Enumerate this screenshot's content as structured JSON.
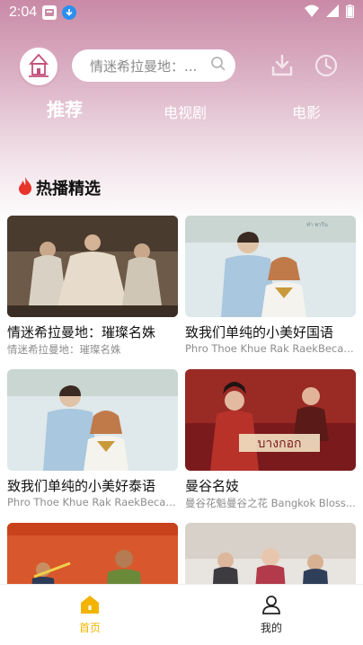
{
  "status_bar": {
    "time": "2:04"
  },
  "search": {
    "placeholder": "情迷希拉曼地：..."
  },
  "tabs": [
    {
      "label": "推荐",
      "active": true
    },
    {
      "label": "电视剧",
      "active": false
    },
    {
      "label": "电影",
      "active": false
    }
  ],
  "section": {
    "title": "热播精选"
  },
  "cards": [
    {
      "title": "情迷希拉曼地：璀璨名姝",
      "subtitle": "情迷希拉曼地：璀璨名姝",
      "poster": "thai-royal-drama-poster"
    },
    {
      "title": "致我们单纯的小美好国语",
      "subtitle": "Phro Thoe Khue Rak RaekBecause...",
      "poster": "couple-school-uniform-poster"
    },
    {
      "title": "致我们单纯的小美好泰语",
      "subtitle": "Phro Thoe Khue Rak RaekBecause...",
      "poster": "couple-school-uniform-poster"
    },
    {
      "title": "曼谷名妓",
      "subtitle": "曼谷花魁曼谷之花 Bangkok Bloss...",
      "poster": "red-drama-poster"
    },
    {
      "title": "",
      "subtitle": "",
      "poster": "orange-comedy-poster"
    },
    {
      "title": "",
      "subtitle": "",
      "poster": "group-cast-poster"
    }
  ],
  "bottom_nav": [
    {
      "label": "首页",
      "active": true
    },
    {
      "label": "我的",
      "active": false
    }
  ],
  "colors": {
    "accent": "#f3b400",
    "header_pink": "#c98aa6",
    "flame": "#e8352b"
  }
}
